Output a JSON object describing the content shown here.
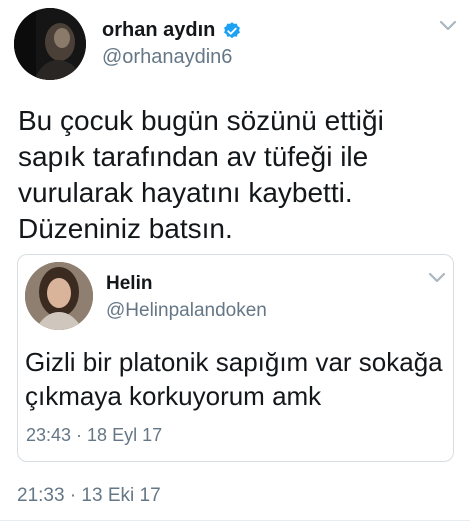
{
  "tweet": {
    "author_name": "orhan aydın",
    "author_handle": "@orhanaydin6",
    "verified": true,
    "text": "Bu çocuk bugün sözünü ettiği sapık tarafından av tüfeği ile vurularak hayatını kaybetti. Düzeniniz batsın.",
    "timestamp": "21:33 · 13 Eki 17",
    "menu_icon": "chevron-down-icon"
  },
  "quoted_tweet": {
    "author_name": "Helin",
    "author_handle": "@Helinpalandoken",
    "text": "Gizli bir platonik sapığım var sokağa çıkmaya korkuyorum amk",
    "timestamp": "23:43 · 18 Eyl 17",
    "menu_icon": "chevron-down-icon"
  },
  "colors": {
    "text_primary": "#14171a",
    "text_secondary": "#657786",
    "verified_blue": "#1da1f2",
    "border": "#d7dee3",
    "chevron": "#aab8c2"
  }
}
